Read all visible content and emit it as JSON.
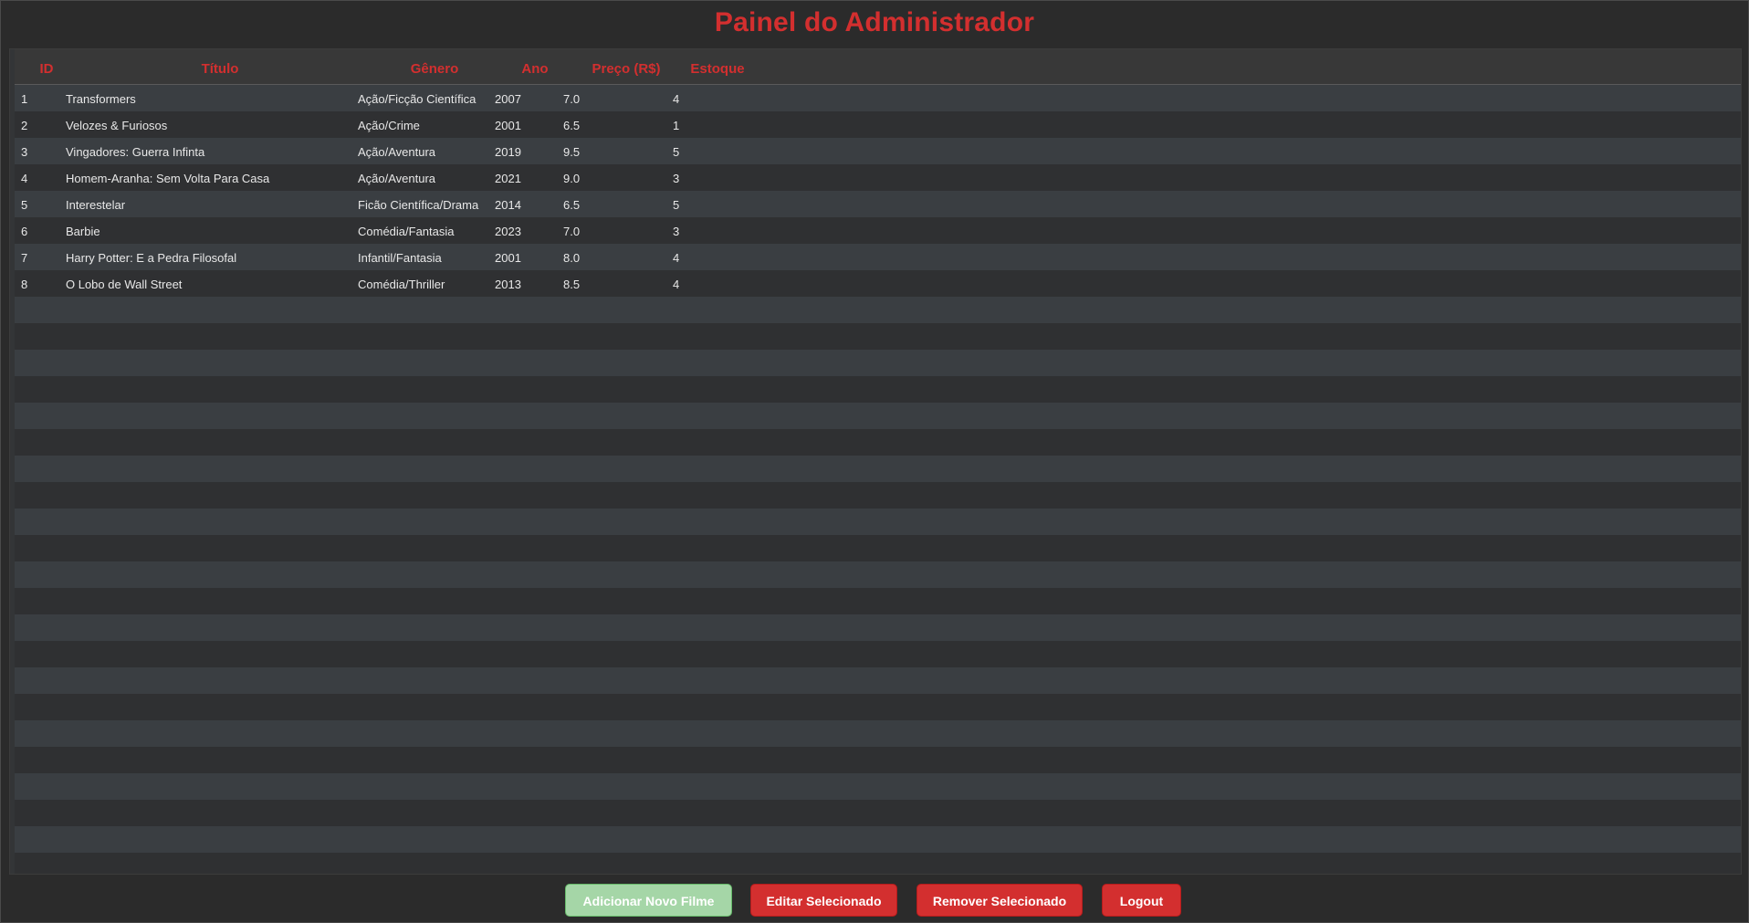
{
  "window": {
    "title": "Painel do Administrador"
  },
  "table": {
    "columns": [
      "ID",
      "Título",
      "Gênero",
      "Ano",
      "Preço (R$)",
      "Estoque"
    ],
    "rows": [
      [
        "1",
        "Transformers",
        "Ação/Ficção Científica",
        "2007",
        "7.0",
        "4"
      ],
      [
        "2",
        "Velozes & Furiosos",
        "Ação/Crime",
        "2001",
        "6.5",
        "1"
      ],
      [
        "3",
        "Vingadores: Guerra Infinta",
        "Ação/Aventura",
        "2019",
        "9.5",
        "5"
      ],
      [
        "4",
        "Homem-Aranha: Sem Volta Para Casa",
        "Ação/Aventura",
        "2021",
        "9.0",
        "3"
      ],
      [
        "5",
        "Interestelar",
        "Ficão Científica/Drama",
        "2014",
        "6.5",
        "5"
      ],
      [
        "6",
        "Barbie",
        "Comédia/Fantasia",
        "2023",
        "7.0",
        "3"
      ],
      [
        "7",
        "Harry Potter: E a Pedra Filosofal",
        "Infantil/Fantasia",
        "2001",
        "8.0",
        "4"
      ],
      [
        "8",
        "O Lobo de Wall Street",
        "Comédia/Thriller",
        "2013",
        "8.5",
        "4"
      ]
    ]
  },
  "buttons": {
    "add": "Adicionar Novo Filme",
    "edit": "Editar Selecionado",
    "remove": "Remover Selecionado",
    "logout": "Logout"
  },
  "colors": {
    "accent": "#d32f2f",
    "add_button": "#a5d6a7",
    "background": "#2b2b2b",
    "row_odd": "#3a3e42",
    "row_even": "#2f3032"
  }
}
